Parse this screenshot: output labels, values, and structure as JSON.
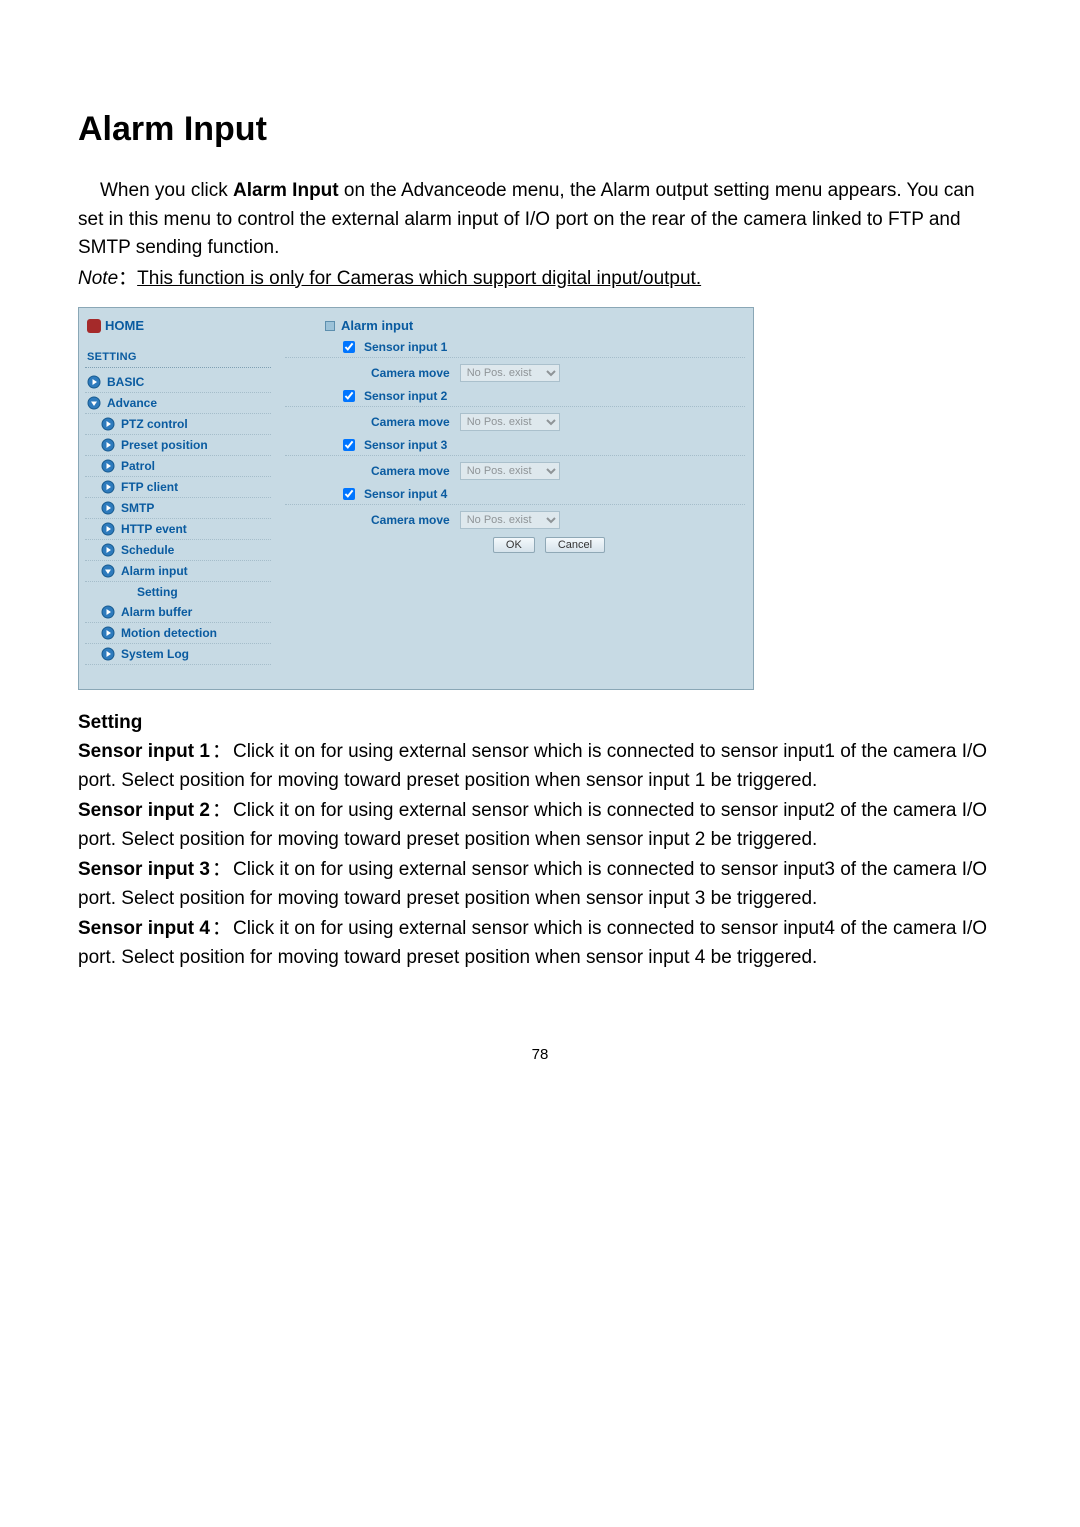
{
  "title": "Alarm Input",
  "intro_parts": [
    "When you click ",
    "Alarm Input",
    " on the Advanceode menu, the Alarm output setting menu appears. You can set in this menu to control the external alarm input of I/O port on the rear of the camera linked to FTP and SMTP sending function."
  ],
  "note": {
    "label": "Note",
    "colon": "：",
    "text": "This function is only for Cameras which support digital input/output."
  },
  "sidebar": {
    "home": "HOME",
    "setting": "SETTING",
    "items": [
      {
        "label": "BASIC",
        "level": 0,
        "bullet": "play"
      },
      {
        "label": "Advance",
        "level": 0,
        "bullet": "down"
      },
      {
        "label": "PTZ control",
        "level": 1,
        "bullet": "play"
      },
      {
        "label": "Preset position",
        "level": 1,
        "bullet": "play"
      },
      {
        "label": "Patrol",
        "level": 1,
        "bullet": "play"
      },
      {
        "label": "FTP client",
        "level": 1,
        "bullet": "play"
      },
      {
        "label": "SMTP",
        "level": 1,
        "bullet": "play"
      },
      {
        "label": "HTTP event",
        "level": 1,
        "bullet": "play"
      },
      {
        "label": "Schedule",
        "level": 1,
        "bullet": "play"
      },
      {
        "label": "Alarm input",
        "level": 1,
        "bullet": "down"
      },
      {
        "label": "Setting",
        "level": 2,
        "bullet": "none"
      },
      {
        "label": "Alarm buffer",
        "level": 1,
        "bullet": "play"
      },
      {
        "label": "Motion detection",
        "level": 1,
        "bullet": "play"
      },
      {
        "label": "System Log",
        "level": 1,
        "bullet": "play"
      }
    ]
  },
  "panel": {
    "title": "Alarm input",
    "sensors": [
      {
        "check_label": "Sensor input 1",
        "cam_label": "Camera move",
        "select_value": "No Pos. exist"
      },
      {
        "check_label": "Sensor input 2",
        "cam_label": "Camera move",
        "select_value": "No Pos. exist"
      },
      {
        "check_label": "Sensor input 3",
        "cam_label": "Camera move",
        "select_value": "No Pos. exist"
      },
      {
        "check_label": "Sensor input 4",
        "cam_label": "Camera move",
        "select_value": "No Pos. exist"
      }
    ],
    "ok": "OK",
    "cancel": "Cancel"
  },
  "setting_heading": "Setting",
  "entries": [
    {
      "name": "Sensor input 1",
      "colon": "：",
      "text": "Click it on for using external sensor which is connected to sensor input1 of the camera I/O port. Select position for moving toward preset position when sensor input 1 be triggered."
    },
    {
      "name": "Sensor input 2",
      "colon": "：",
      "text": "Click it on for using external sensor which is connected to sensor input2 of the camera I/O port. Select position for moving toward preset position when sensor input 2 be triggered."
    },
    {
      "name": "Sensor input 3",
      "colon": "：",
      "text": "Click it on for using external sensor which is connected to sensor input3 of the camera I/O port. Select position for moving toward preset position when sensor input 3 be triggered."
    },
    {
      "name": "Sensor input 4",
      "colon": "：",
      "text": "Click it on for using external sensor which is connected to sensor input4 of the camera I/O port. Select position for moving toward preset position when sensor input 4 be triggered."
    }
  ],
  "page_number": "78"
}
